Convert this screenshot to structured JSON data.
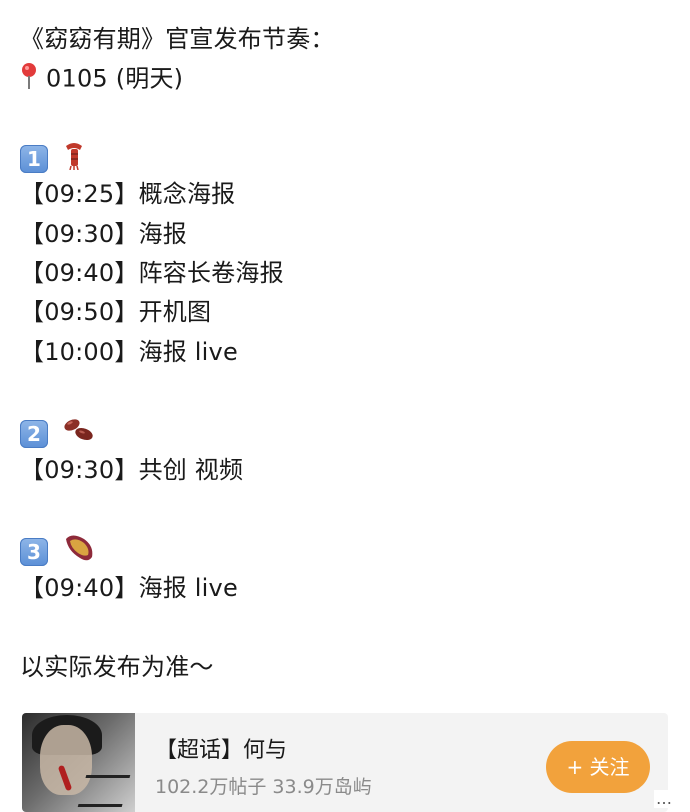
{
  "post": {
    "title": "《窈窈有期》官宣发布节奏：",
    "date": "0105 (明天)",
    "sections": [
      {
        "number": "1",
        "emoji": "scarf",
        "items": [
          {
            "time": "【09:25】",
            "text": "概念海报"
          },
          {
            "time": "【09:30】",
            "text": "海报"
          },
          {
            "time": "【09:40】",
            "text": "阵容长卷海报"
          },
          {
            "time": "【09:50】",
            "text": "开机图"
          },
          {
            "time": "【10:00】",
            "text": "海报 live"
          }
        ]
      },
      {
        "number": "2",
        "emoji": "beans",
        "items": [
          {
            "time": "【09:30】",
            "text": "共创 视频"
          }
        ]
      },
      {
        "number": "3",
        "emoji": "sweet-potato",
        "items": [
          {
            "time": "【09:40】",
            "text": "海报 live"
          }
        ]
      }
    ],
    "footer": "以实际发布为准～"
  },
  "supertopic_card": {
    "title": "【超话】何与",
    "meta": "102.2万帖子  33.9万岛屿",
    "follow_label": "+ 关注",
    "more": "…"
  },
  "colors": {
    "follow_button": "#f2a23c",
    "badge": "#5b8fd6",
    "meta_text": "#8a8a8a"
  }
}
